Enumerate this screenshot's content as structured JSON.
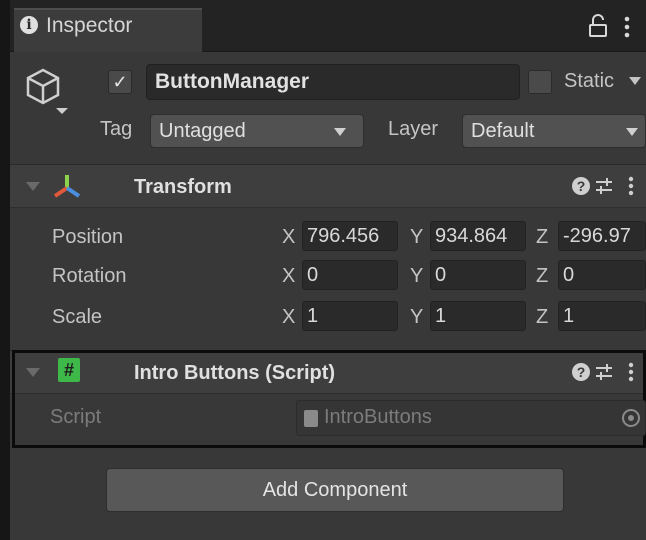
{
  "tab": {
    "label": "Inspector"
  },
  "gameobject": {
    "active": true,
    "name": "ButtonManager",
    "static_label": "Static",
    "tag_label": "Tag",
    "tag_value": "Untagged",
    "layer_label": "Layer",
    "layer_value": "Default"
  },
  "transform": {
    "title": "Transform",
    "rows": [
      {
        "label": "Position",
        "x": "796.456",
        "y": "934.864",
        "z": "-296.97"
      },
      {
        "label": "Rotation",
        "x": "0",
        "y": "0",
        "z": "0"
      },
      {
        "label": "Scale",
        "x": "1",
        "y": "1",
        "z": "1"
      }
    ],
    "axes": {
      "x": "X",
      "y": "Y",
      "z": "Z"
    }
  },
  "script_component": {
    "title": "Intro Buttons (Script)",
    "field_label": "Script",
    "field_value": "IntroButtons"
  },
  "add_component_label": "Add Component",
  "colors": {
    "panel_bg": "#383838",
    "header_bg": "#3e3e3e",
    "field_bg": "#2a2a2a",
    "script_icon": "#3fb84a",
    "transform_icon_y": "#8cd24a",
    "transform_icon_x": "#e0573a",
    "transform_icon_z": "#4a8fe0"
  }
}
